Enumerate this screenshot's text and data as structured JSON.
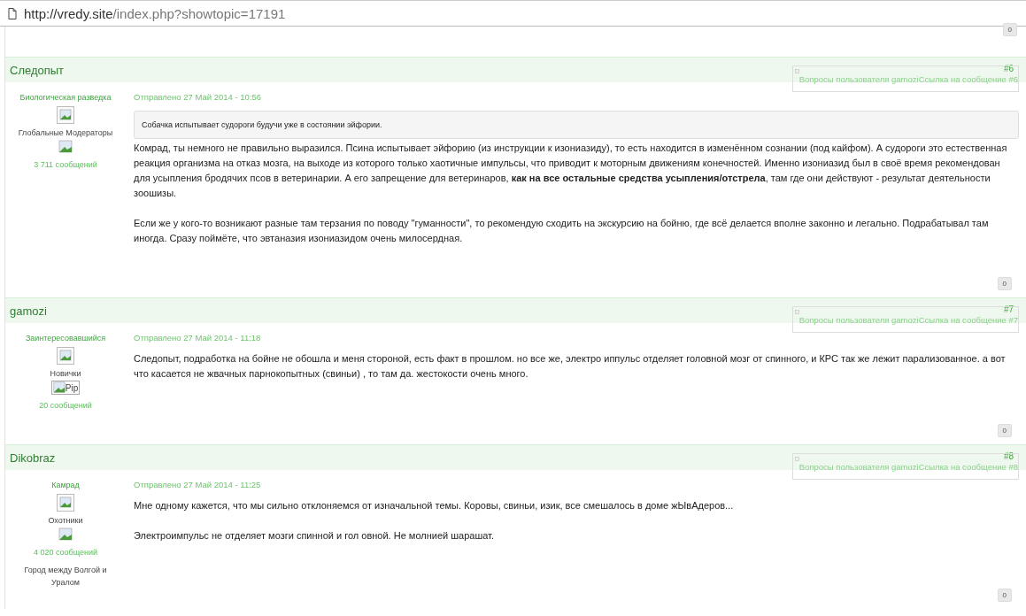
{
  "address_bar": {
    "host": "http://vredy.site",
    "path": "/index.php?showtopic=17191"
  },
  "prev_post": {
    "reputation": "0"
  },
  "posts": [
    {
      "author": "Следопыт",
      "number": "#6",
      "link_alt": "Вопросы пользователя gamoziСсылка на сообщение #6",
      "rank": "Биологическая разведка",
      "group": "Глобальные Модераторы",
      "group_icon": {
        "kind": "broken"
      },
      "post_count": "3 711 сообщений",
      "date": "Отправлено 27 Май 2014 - 10:56",
      "quote": "Собачка испытывает судороги будучи уже в состоянии эйфории.",
      "paragraphs": [
        "Комрад, ты немного не правильно выразился.   Псина  испытывает эйфорию (из инструкции к изониазиду), то есть находится в изменённом сознании (под кайфом).  А судороги это естественная реакция организма на отказ мозга, на выходе из которого только хаотичные импульсы, что приводит к моторным движениям конечностей.  Именно изониазид был в своё время рекомендован для усыпления бродячих псов в ветеринарии. А его запрещение для ветеринаров, **как на все остальные средства усыпления/отстрела**, там где они действуют - результат деятельности зоошизы.",
        "Если же у кого-то возникают разные там терзания по поводу \"гуманности\", то рекомендую сходить на экскурсию на бойню, где всё делается вполне законно и легально. Подрабатывал там иногда. Сразу поймёте, что эвтаназия изониазидом очень милосердная."
      ],
      "reputation": "0"
    },
    {
      "author": "gamozi",
      "number": "#7",
      "link_alt": "Вопросы пользователя gamoziСсылка на сообщение #7",
      "rank": "Заинтересовавшийся",
      "group": "Новички",
      "group_icon": {
        "kind": "broken_alt",
        "alt": "Pip"
      },
      "post_count": "20 сообщений",
      "date": "Отправлено 27 Май 2014 - 11:18",
      "paragraphs": [
        "Следопыт, подработка на бойне не обошла и меня стороной,  есть факт в прошлом. но все же, электро иппульс отделяет головной мозг от спинного, и КРС так же лежит парализованное. а вот что касается не жвачных парнокопытных (свиньи) , то там да. жестокости очень много."
      ],
      "reputation": "0"
    },
    {
      "author": "Dikobraz",
      "number": "#8",
      "link_alt": "Вопросы пользователя gamoziСсылка на сообщение #8",
      "rank": "Камрад",
      "group": "Охотники",
      "group_icon": {
        "kind": "broken"
      },
      "post_count": "4 020 сообщений",
      "location": "Город между Волгой и Уралом",
      "date": "Отправлено 27 Май 2014 - 11:25",
      "paragraphs": [
        "Мне одному кажется, что мы сильно отклоняемся от изначальной темы. Коровы, свиньи, изик, все смешалось в доме жЫвАдеров...",
        "Электроимпульс не отделяет мозги спинной и гол овной. Не молнией шарашат."
      ],
      "reputation": "0"
    }
  ]
}
